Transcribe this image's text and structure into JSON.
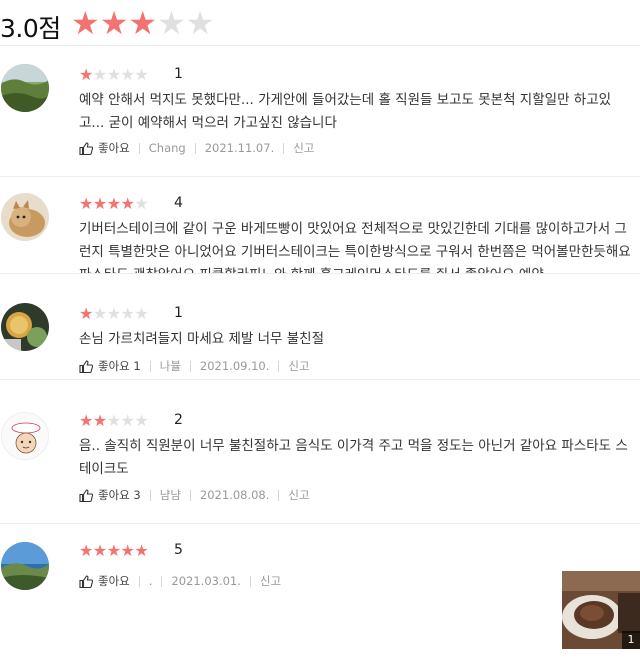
{
  "summary": {
    "score": "3.0점",
    "stars_filled": 3,
    "stars_total": 5
  },
  "reviews": [
    {
      "rating_value": "1",
      "stars": "★",
      "empty_stars": "★★★★",
      "text": "예약 안해서 먹지도 못했다만... 가게안에 들어갔는데 홀 직원들 보고도 못본척 지할일만 하고있고... 굳이 예약해서 먹으러 가고싶진 않습니다",
      "like_label": "좋아요",
      "like_count": "",
      "author": "Chang",
      "date": "2021.11.07.",
      "report_label": "신고"
    },
    {
      "rating_value": "4",
      "stars": "★★★★",
      "empty_stars": "★",
      "text": "기버터스테이크에 같이 구운 바게뜨빵이 맛있어요 전체적으로 맛있긴한데 기대를 많이하고가서 그런지 특별한맛은 아니었어요 기버터스테이크는 특이한방식으로 구워서 한번쯤은 먹어볼만한듯해요 파스타도 괜찮았어요 피클할라피뇨와 함께 홀그레인머스타드를 줘서 좋았어요 예약"
    },
    {
      "rating_value": "1",
      "stars": "★",
      "empty_stars": "★★★★",
      "text": "손님 가르치려들지 마세요 제발 너무 불친절",
      "like_label": "좋아요",
      "like_count": "1",
      "author": "나뷸",
      "date": "2021.09.10.",
      "report_label": "신고"
    },
    {
      "rating_value": "2",
      "stars": "★★",
      "empty_stars": "★★★",
      "text": "음.. 솔직히 직원분이 너무 불친절하고 음식도 이가격 주고 먹을 정도는 아닌거 같아요 파스타도 스테이크도",
      "like_label": "좋아요",
      "like_count": "3",
      "author": "냠냠",
      "date": "2021.08.08.",
      "report_label": "신고"
    },
    {
      "rating_value": "5",
      "stars": "★★★★★",
      "empty_stars": "",
      "text": "",
      "like_label": "좋아요",
      "like_count": "",
      "author": ".",
      "date": "2021.03.01.",
      "report_label": "신고"
    }
  ],
  "photo": {
    "count": "1"
  },
  "colors": {
    "star_on": "#f27370",
    "star_off": "#e0e0e0"
  },
  "icons": {
    "like": "thumbs-up-icon"
  }
}
